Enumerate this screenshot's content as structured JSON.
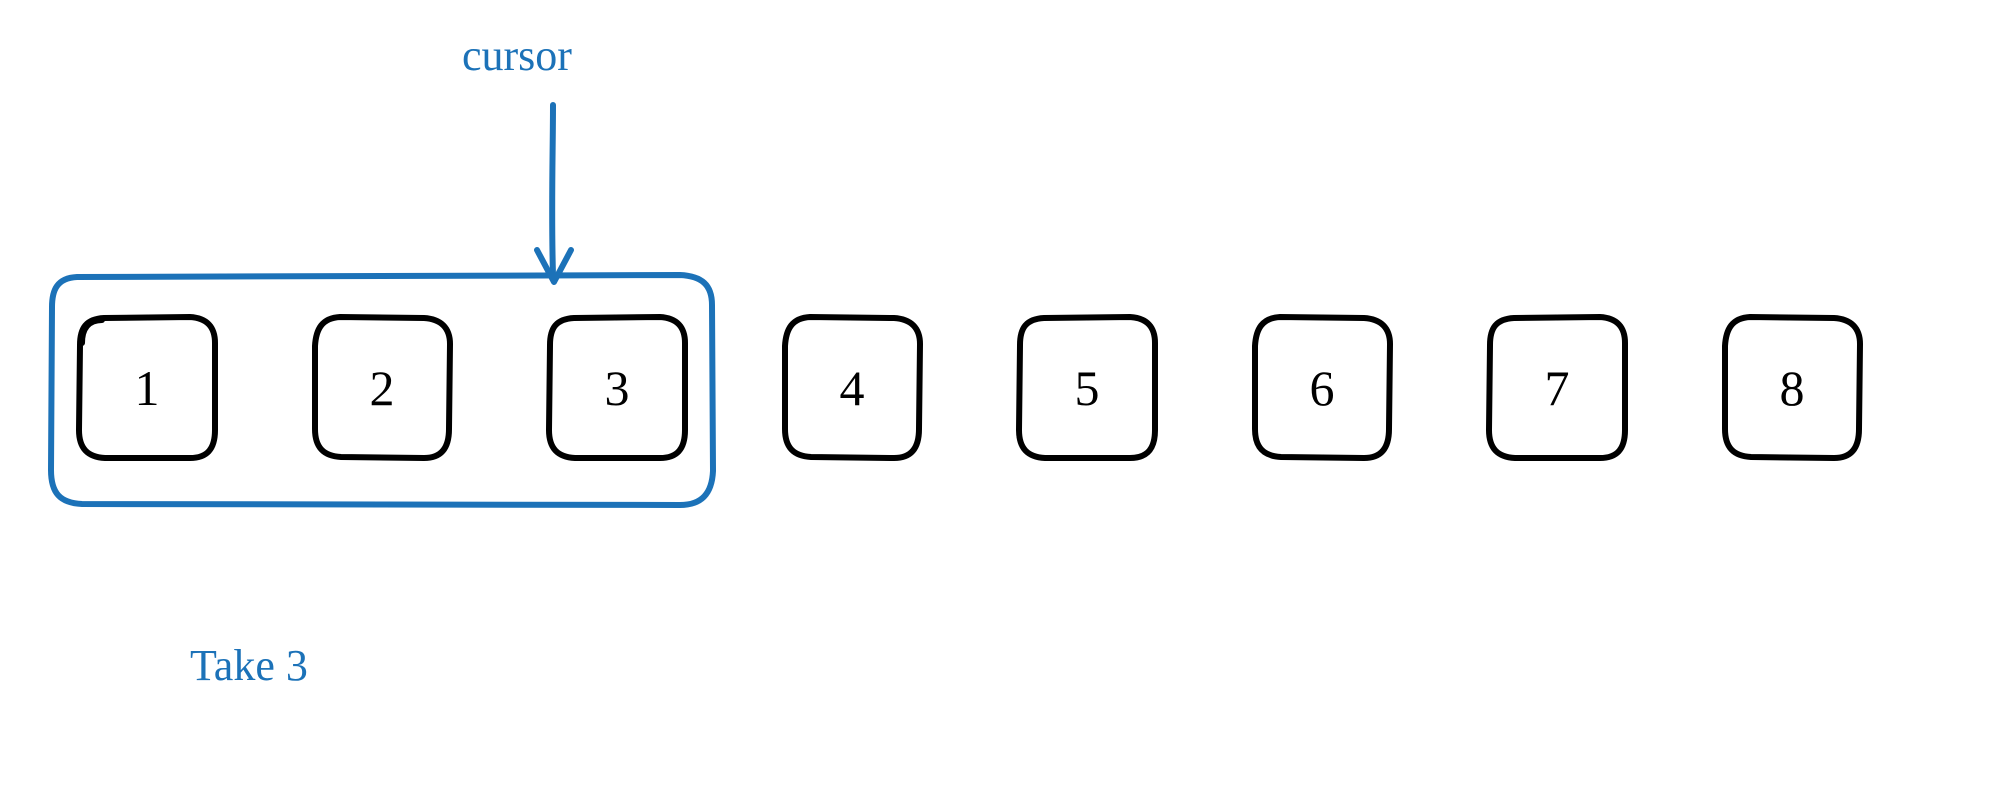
{
  "labels": {
    "cursor": "cursor",
    "take": "Take 3"
  },
  "boxes": [
    "1",
    "2",
    "3",
    "4",
    "5",
    "6",
    "7",
    "8"
  ],
  "cursor_target_index": 2,
  "take_count": 3,
  "colors": {
    "accent": "#1c72b8",
    "ink": "#000000"
  }
}
